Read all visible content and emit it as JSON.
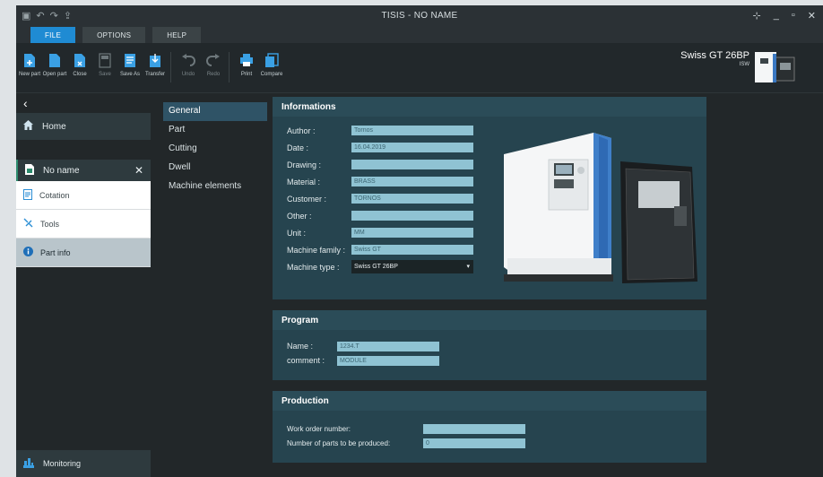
{
  "window": {
    "title": "TISIS - NO NAME",
    "min": "_",
    "max": "▫",
    "close": "✕",
    "pin": "⊹"
  },
  "menu": {
    "tabs": [
      "FILE",
      "OPTIONS",
      "HELP"
    ],
    "active": 0
  },
  "ribbon": {
    "buttons": [
      {
        "label": "New part",
        "icon": "new-part-icon"
      },
      {
        "label": "Open part",
        "icon": "open-part-icon"
      },
      {
        "label": "Close",
        "icon": "close-file-icon"
      },
      {
        "label": "Save",
        "icon": "save-icon"
      },
      {
        "label": "Save As",
        "icon": "save-as-icon"
      },
      {
        "label": "Transfer",
        "icon": "transfer-icon"
      },
      {
        "label": "Undo",
        "icon": "undo-icon"
      },
      {
        "label": "Redo",
        "icon": "redo-icon"
      },
      {
        "label": "Print",
        "icon": "print-icon"
      },
      {
        "label": "Compare",
        "icon": "compare-icon"
      }
    ],
    "machine_name": "Swiss GT 26BP",
    "machine_sub": "ISW"
  },
  "sidebar": {
    "back": "‹",
    "home": "Home",
    "document": "No name",
    "document_close": "✕",
    "items": [
      "Cotation",
      "Tools",
      "Part info"
    ],
    "active_item": 2,
    "monitoring": "Monitoring"
  },
  "subnav": {
    "items": [
      "General",
      "Part",
      "Cutting",
      "Dwell",
      "Machine elements"
    ],
    "active": 0
  },
  "informations": {
    "title": "Informations",
    "fields": [
      {
        "label": "Author :",
        "value": "Tornos"
      },
      {
        "label": "Date :",
        "value": "16.04.2019"
      },
      {
        "label": "Drawing :",
        "value": ""
      },
      {
        "label": "Material :",
        "value": "BRASS"
      },
      {
        "label": "Customer :",
        "value": "TORNOS"
      },
      {
        "label": "Other :",
        "value": ""
      },
      {
        "label": "Unit :",
        "value": "MM"
      },
      {
        "label": "Machine family :",
        "value": "Swiss GT"
      },
      {
        "label": "Machine type :",
        "value": "Swiss GT 26BP"
      }
    ]
  },
  "program": {
    "title": "Program",
    "fields": [
      {
        "label": "Name :",
        "value": "1234.T"
      },
      {
        "label": "comment :",
        "value": "MODULE"
      }
    ]
  },
  "production": {
    "title": "Production",
    "fields": [
      {
        "label": "Work order number:",
        "value": ""
      },
      {
        "label": "Number of parts to be produced:",
        "value": "0"
      }
    ]
  },
  "colors": {
    "accent": "#1f8bd3",
    "panel": "#26444f",
    "field": "#8fc3d3"
  }
}
